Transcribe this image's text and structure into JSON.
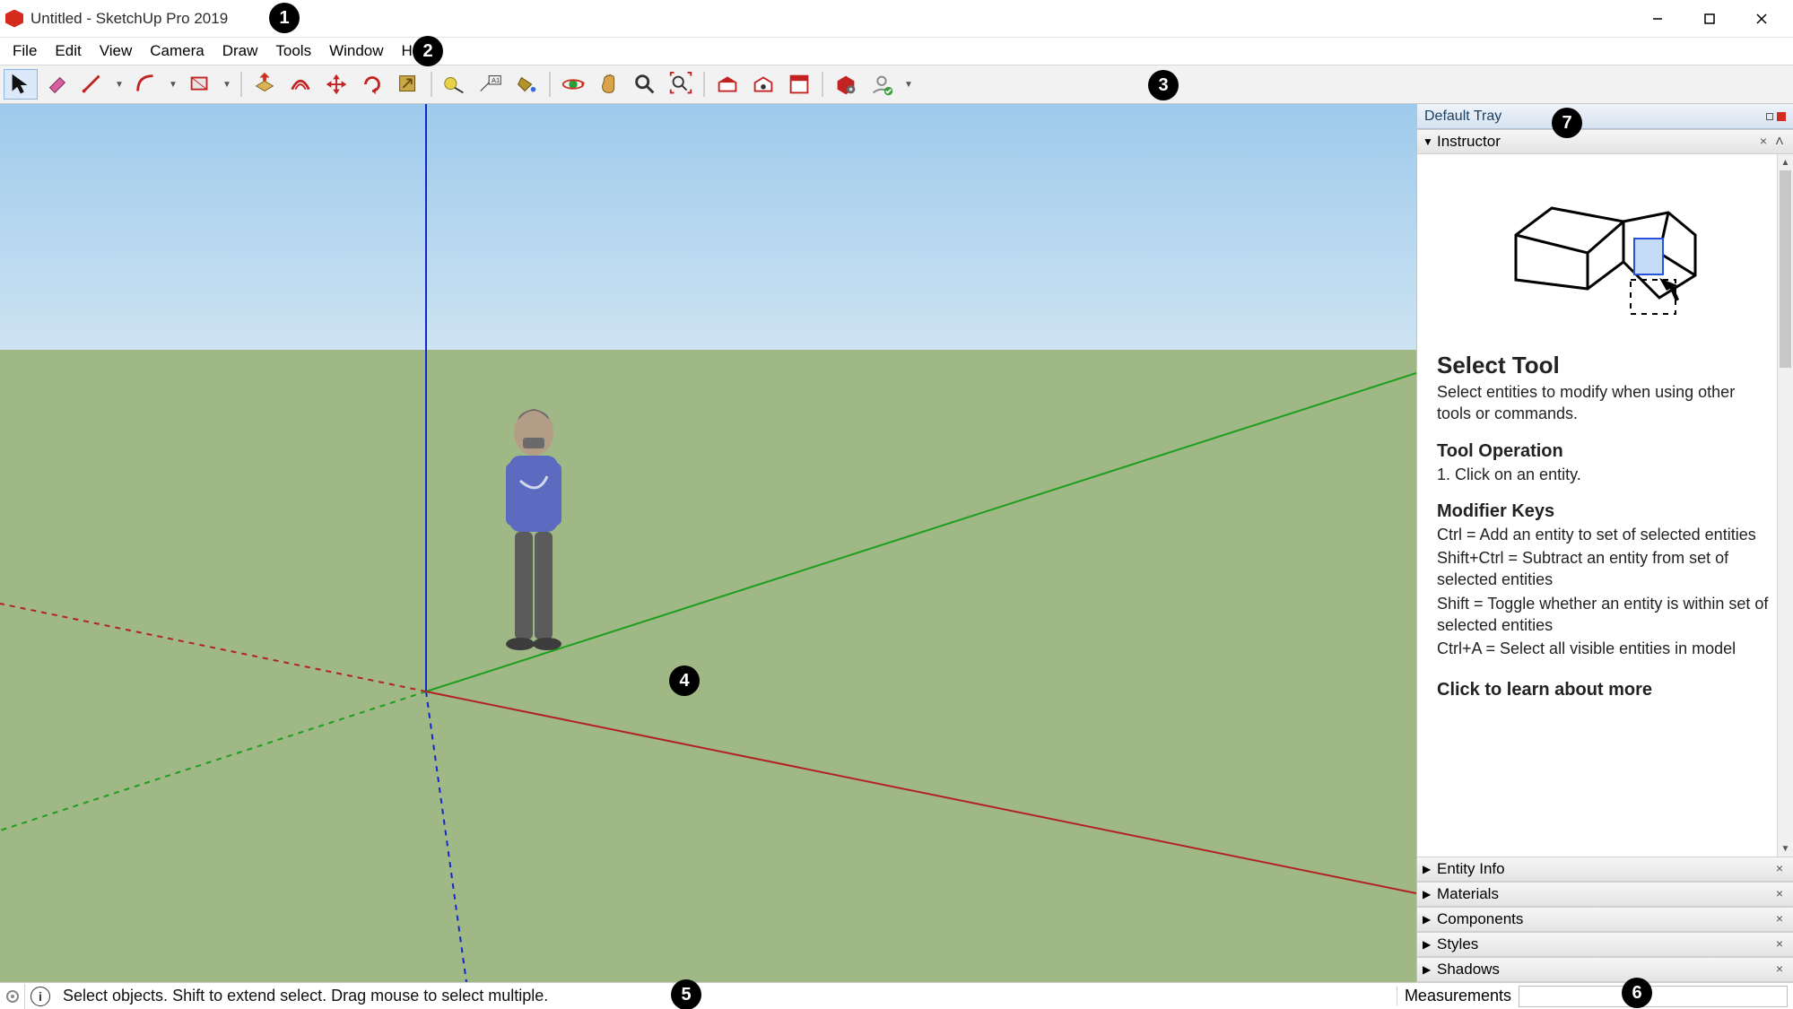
{
  "titlebar": {
    "title": "Untitled - SketchUp Pro 2019"
  },
  "menu": [
    "File",
    "Edit",
    "View",
    "Camera",
    "Draw",
    "Tools",
    "Window",
    "Help"
  ],
  "toolbar_groups": [
    {
      "items": [
        {
          "name": "select-tool",
          "selected": true,
          "color": "#111"
        },
        {
          "name": "eraser-tool",
          "color": "#d65fa2"
        },
        {
          "name": "line-tool",
          "color": "#c32222",
          "dropdown": true
        },
        {
          "name": "arc-tool",
          "color": "#c32222",
          "dropdown": true
        },
        {
          "name": "rectangle-tool",
          "color": "#c32222",
          "dropdown": true
        }
      ]
    },
    {
      "items": [
        {
          "name": "push-pull-tool",
          "color": "#d39a2f"
        },
        {
          "name": "offset-tool",
          "color": "#c32222"
        },
        {
          "name": "move-tool",
          "color": "#c32222"
        },
        {
          "name": "rotate-tool",
          "color": "#c32222"
        },
        {
          "name": "scale-tool",
          "color": "#8a6a2a"
        }
      ]
    },
    {
      "items": [
        {
          "name": "tape-measure-tool",
          "color": "#d6c63b"
        },
        {
          "name": "text-tool",
          "color": "#444"
        },
        {
          "name": "paint-bucket-tool",
          "color": "#b3942a"
        }
      ]
    },
    {
      "items": [
        {
          "name": "orbit-tool",
          "color": "#2a9c3a"
        },
        {
          "name": "pan-tool",
          "color": "#d9a24b"
        },
        {
          "name": "zoom-tool",
          "color": "#2b2b2b"
        },
        {
          "name": "zoom-extents-tool",
          "color": "#c32222"
        }
      ]
    },
    {
      "items": [
        {
          "name": "3d-warehouse-tool",
          "color": "#c32222"
        },
        {
          "name": "extension-warehouse-tool",
          "color": "#c32222"
        },
        {
          "name": "layout-tool",
          "color": "#c32222"
        }
      ]
    },
    {
      "items": [
        {
          "name": "extension-manager-tool",
          "color": "#c32222"
        },
        {
          "name": "user-sign-in",
          "color": "#888",
          "dropdown": true
        }
      ]
    }
  ],
  "tray": {
    "title": "Default Tray",
    "open_panel": "Instructor",
    "panels": [
      "Entity Info",
      "Materials",
      "Components",
      "Styles",
      "Shadows"
    ],
    "instructor": {
      "title": "Select Tool",
      "summary": "Select entities to modify when using other tools or commands.",
      "operation_title": "Tool Operation",
      "operation_1": "1. Click on an entity.",
      "modifier_title": "Modifier Keys",
      "mod_ctrl": "Ctrl = Add an entity to set of selected entities",
      "mod_shiftctrl": "Shift+Ctrl = Subtract an entity from set of selected entities",
      "mod_shift": "Shift = Toggle whether an entity is within set of selected entities",
      "mod_ctrla": "Ctrl+A = Select all visible entities in model",
      "learn_more": "Click to learn about more"
    }
  },
  "status": {
    "hint": "Select objects. Shift to extend select. Drag mouse to select multiple.",
    "measurements_label": "Measurements"
  },
  "callouts": [
    "1",
    "2",
    "3",
    "4",
    "5",
    "6",
    "7"
  ]
}
